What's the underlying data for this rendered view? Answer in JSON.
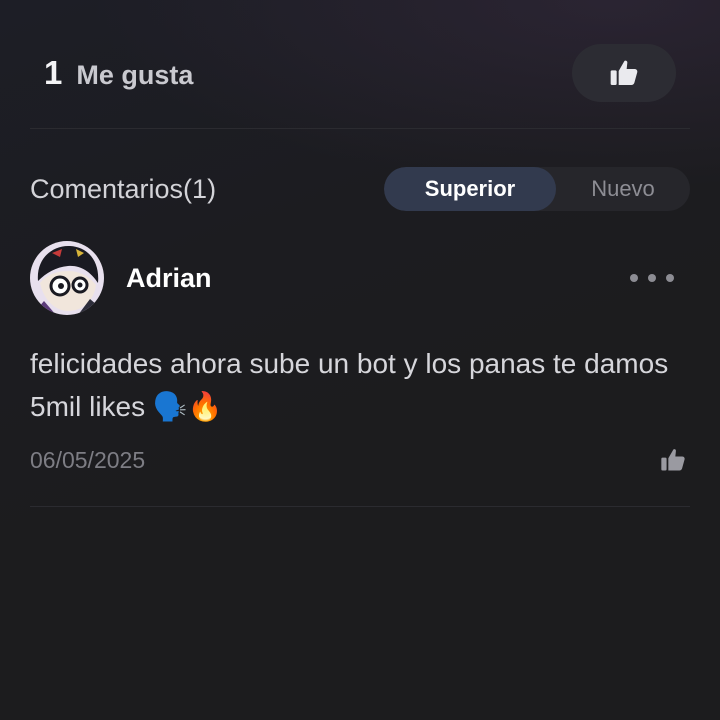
{
  "likes": {
    "count": "1",
    "label": "Me gusta"
  },
  "comments": {
    "title": "Comentarios(1)",
    "sort": {
      "options": [
        "Superior",
        "Nuevo"
      ],
      "selected": "Superior"
    },
    "items": [
      {
        "author": "Adrian",
        "text": "felicidades ahora sube un bot y los panas te damos 5mil likes 🗣️🔥",
        "date": "06/05/2025"
      }
    ]
  },
  "colors": {
    "background": "#1c1c1e",
    "active_tab": "#323a4e",
    "like_button_bg": "#2c2c33"
  },
  "icons": {
    "like_button": "thumbs-up-icon",
    "comment_like": "thumbs-up-icon",
    "more": "more-horizontal-icon"
  }
}
